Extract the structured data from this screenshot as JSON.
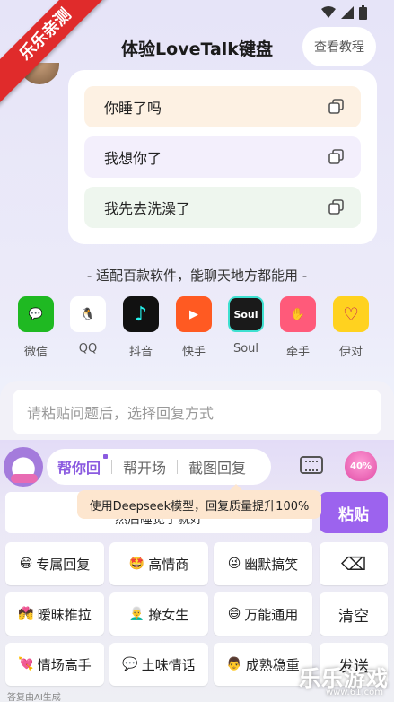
{
  "status_bar": {
    "icons": [
      "wifi-icon",
      "signal-icon",
      "battery-icon"
    ]
  },
  "ribbon": {
    "text": "乐乐亲测"
  },
  "header": {
    "title": "体验LoveTalk键盘",
    "tutorial_button": "查看教程"
  },
  "phrases": [
    {
      "text": "你睡了吗",
      "bg": "#fdf1e3"
    },
    {
      "text": "我想你了",
      "bg": "#f3effc"
    },
    {
      "text": "我先去洗澡了",
      "bg": "#eef6ee"
    }
  ],
  "apps_caption": "- 适配百款软件，能聊天地方都能用 -",
  "apps": [
    {
      "label": "微信",
      "color": "#1fb922",
      "glyph": "💬"
    },
    {
      "label": "QQ",
      "color": "#ffffff",
      "glyph": "🐧"
    },
    {
      "label": "抖音",
      "color": "#111111",
      "glyph": "♪"
    },
    {
      "label": "快手",
      "color": "#ff5a22",
      "glyph": "▶"
    },
    {
      "label": "Soul",
      "color": "#1a1a1a",
      "glyph": "Soul"
    },
    {
      "label": "牵手",
      "color": "#ff5a7a",
      "glyph": "✋"
    },
    {
      "label": "伊对",
      "color": "#ffd21f",
      "glyph": "♡"
    }
  ],
  "paste_input": {
    "placeholder": "请粘贴问题后，选择回复方式"
  },
  "keyboard": {
    "tabs": [
      "帮你回",
      "帮开场",
      "截图回复"
    ],
    "active_tab": "帮你回",
    "heart_badge": "40%",
    "tooltip": "使用Deepseek模型，回复质量提升100%",
    "question_text": "然后睡觉了就好",
    "paste_button": "粘贴",
    "reply_keys": [
      {
        "emoji": "😁",
        "label": "专属回复"
      },
      {
        "emoji": "🤩",
        "label": "高情商"
      },
      {
        "emoji": "😜",
        "label": "幽默搞笑"
      },
      {
        "emoji": "💏",
        "label": "暧昧推拉"
      },
      {
        "emoji": "👨‍🦳",
        "label": "撩女生"
      },
      {
        "emoji": "😄",
        "label": "万能通用"
      },
      {
        "emoji": "💘",
        "label": "情场高手"
      },
      {
        "emoji": "💬",
        "label": "土味情话"
      },
      {
        "emoji": "👨",
        "label": "成熟稳重"
      }
    ],
    "side_keys": {
      "backspace": "⌫",
      "clear": "清空",
      "send": "发送"
    }
  },
  "footer_note": "答复由AI生成",
  "watermark": {
    "text": "乐乐游戏",
    "url": "www.61.com"
  }
}
